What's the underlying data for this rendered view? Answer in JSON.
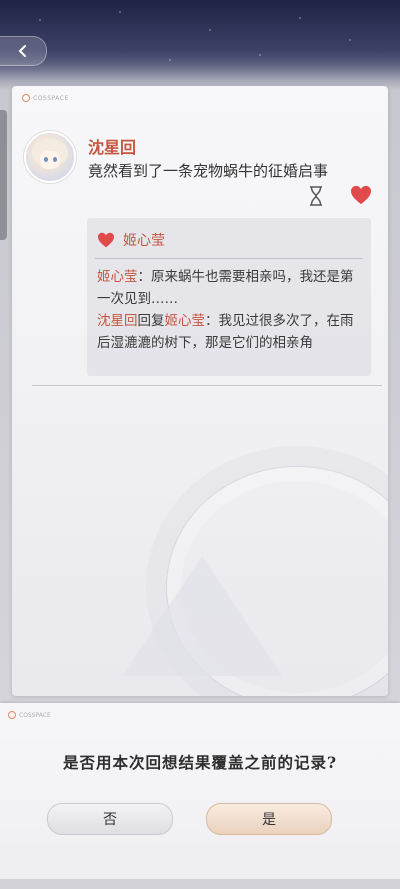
{
  "post": {
    "brand": "COSSPACE",
    "author": "沈星回",
    "text": "竟然看到了一条宠物蜗牛的征婚启事",
    "liked_by": "姬心莹",
    "comments": [
      {
        "name": "姬心莹",
        "text": "：原来蜗牛也需要相亲吗，我还是第一次见到……"
      },
      {
        "name": "沈星回",
        "reply_word": "回复",
        "reply_to": "姬心莹",
        "text": "：我见过很多次了，在雨后湿漉漉的树下，那是它们的相亲角"
      }
    ]
  },
  "dialog": {
    "brand": "COSSPACE",
    "question": "是否用本次回想结果覆盖之前的记录?",
    "no_label": "否",
    "yes_label": "是"
  },
  "colors": {
    "accent_name": "#c4553f",
    "heart": "#e14a4a"
  }
}
